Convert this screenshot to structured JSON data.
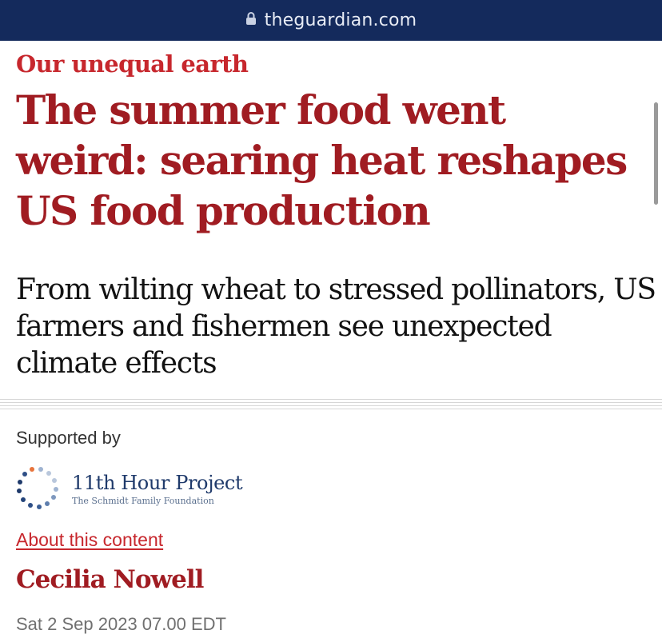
{
  "browser": {
    "domain": "theguardian.com",
    "lock_icon": "lock-icon"
  },
  "article": {
    "kicker": "Our unequal earth",
    "headline": "The summer food went weird: searing heat reshapes US food production",
    "standfirst": "From wilting wheat to stressed pollinators, US farmers and fishermen see unexpected climate effects",
    "supported_by": "Supported by",
    "sponsor": {
      "name": "11th Hour Project",
      "subtitle": "The Schmidt Family Foundation",
      "logo_icon": "dotted-circle-logo-icon"
    },
    "about_link": "About this content",
    "author": "Cecilia Nowell",
    "date": "Sat 2 Sep 2023 07.00 EDT"
  },
  "colors": {
    "url_bar": "#142A5C",
    "headline_red": "#A01C22",
    "link_red": "#C7272D",
    "sponsor_blue": "#1F3A6B"
  }
}
